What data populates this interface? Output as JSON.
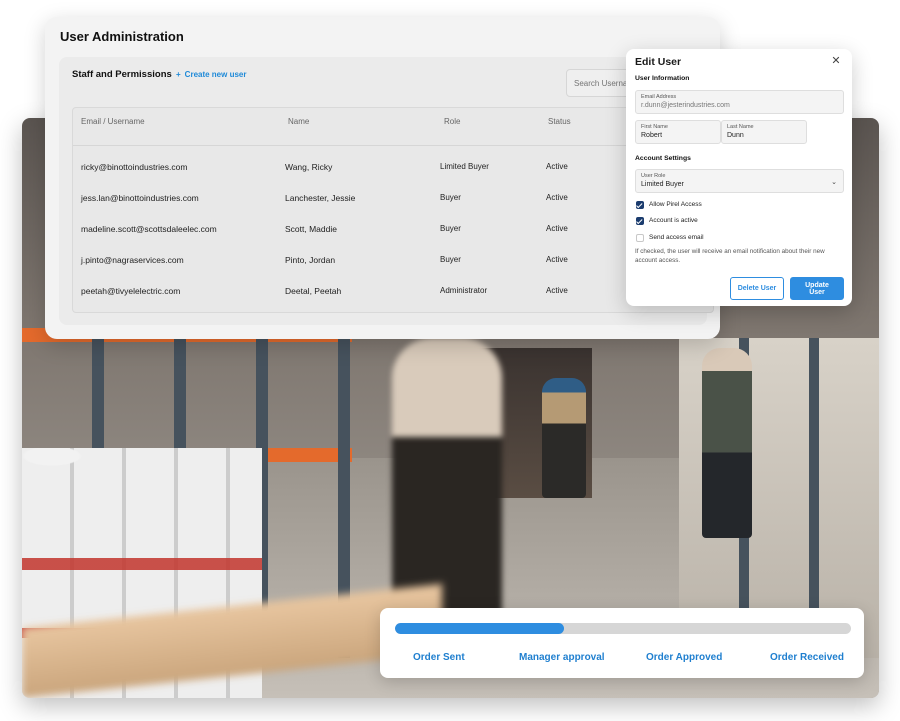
{
  "admin": {
    "title": "User Administration",
    "panel_title": "Staff and Permissions",
    "create_link_icon": "+",
    "create_link": "Create new user",
    "search_placeholder": "Search Username",
    "columns": [
      "Email / Username",
      "Name",
      "Role",
      "Status"
    ],
    "rows": [
      {
        "email": "ricky@binottoindustries.com",
        "name": "Wang, Ricky",
        "role": "Limited Buyer",
        "status": "Active"
      },
      {
        "email": "jess.lan@binottoindustries.com",
        "name": "Lanchester, Jessie",
        "role": "Buyer",
        "status": "Active"
      },
      {
        "email": "madeline.scott@scottsdaleelec.com",
        "name": "Scott, Maddie",
        "role": "Buyer",
        "status": "Active"
      },
      {
        "email": "j.pinto@nagraservices.com",
        "name": "Pinto, Jordan",
        "role": "Buyer",
        "status": "Active"
      },
      {
        "email": "peetah@tivyelelectric.com",
        "name": "Deetal, Peetah",
        "role": "Administrator",
        "status": "Active"
      }
    ]
  },
  "modal": {
    "title": "Edit User",
    "close_icon": "✕",
    "user_info_label": "User Information",
    "email_label": "Email Address",
    "email_value": "r.dunn@jesterindustries.com",
    "first_name_label": "First Name",
    "first_name_value": "Robert",
    "last_name_label": "Last Name",
    "last_name_value": "Dunn",
    "account_settings_label": "Account Settings",
    "role_label": "User Role",
    "role_value": "Limited Buyer",
    "chevron_icon": "⌄",
    "checkboxes": [
      {
        "label": "Allow Pirel Access",
        "checked": true
      },
      {
        "label": "Account is active",
        "checked": true
      },
      {
        "label": "Send access email",
        "checked": false
      }
    ],
    "note": "If checked, the user will receive an email notification about their new account access.",
    "delete_label": "Delete User",
    "update_label": "Update User"
  },
  "progress": {
    "fraction": 0.37,
    "steps": [
      "Order Sent",
      "Manager approval",
      "Order Approved",
      "Order Received"
    ]
  },
  "colors": {
    "accent": "#2e8de0",
    "checkbox_on": "#1b3c6e"
  }
}
